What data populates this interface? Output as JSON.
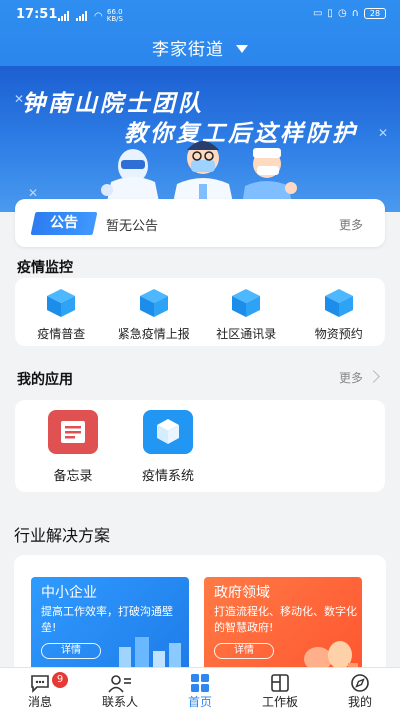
{
  "status": {
    "time": "17:51",
    "net_speed_top": "66.0",
    "net_speed_bottom": "KB/S",
    "battery": "28"
  },
  "header": {
    "title": "李家街道"
  },
  "banner": {
    "line1": "钟南山院士团队",
    "line2": "教你复工后这样防护"
  },
  "notice": {
    "badge": "公告",
    "message": "暂无公告",
    "more": "更多"
  },
  "monitor": {
    "title": "疫情监控",
    "items": [
      {
        "label": "疫情普查"
      },
      {
        "label": "紧急疫情上报"
      },
      {
        "label": "社区通讯录"
      },
      {
        "label": "物资预约"
      }
    ]
  },
  "my_apps": {
    "title": "我的应用",
    "more": "更多",
    "items": [
      {
        "label": "备忘录"
      },
      {
        "label": "疫情系统"
      }
    ]
  },
  "industry": {
    "title": "行业解决方案",
    "tiles": [
      {
        "title": "中小企业",
        "desc": "提高工作效率，打破沟通壁垒!",
        "button": "详情"
      },
      {
        "title": "政府领域",
        "desc": "打造流程化、移动化、数字化的智慧政府!",
        "button": "详情"
      }
    ]
  },
  "nav": {
    "items": [
      {
        "label": "消息",
        "badge": "9"
      },
      {
        "label": "联系人"
      },
      {
        "label": "首页"
      },
      {
        "label": "工作板"
      },
      {
        "label": "我的"
      }
    ]
  },
  "colors": {
    "primary": "#2f86ee",
    "badge_red": "#e53935",
    "memo_red": "#e05252",
    "tile_blue": "#2b8df2",
    "tile_orange": "#ff6a3d"
  }
}
